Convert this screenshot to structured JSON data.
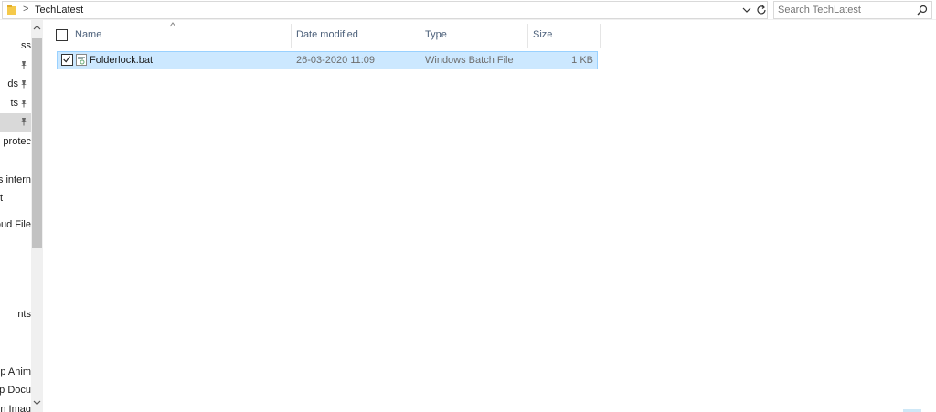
{
  "address_bar": {
    "breadcrumb_separator": ">",
    "current_folder": "TechLatest"
  },
  "search": {
    "placeholder": "Search TechLatest"
  },
  "nav_pane": {
    "items": [
      {
        "label": "ss",
        "pinned": false
      },
      {
        "label": "",
        "pinned": true
      },
      {
        "label": "ds",
        "pinned": true
      },
      {
        "label": "ts",
        "pinned": true
      },
      {
        "label": "",
        "pinned": true,
        "selected": true
      },
      {
        "label": "l protec",
        "pinned": false
      },
      {
        "label": "s intern",
        "pinned": false
      },
      {
        "label": "t",
        "pinned": false
      },
      {
        "label": "oud File",
        "pinned": false
      },
      {
        "label": "nts",
        "pinned": false
      },
      {
        "label": "p Anim",
        "pinned": false
      },
      {
        "label": "p Docu",
        "pinned": false
      },
      {
        "label": "n Imag",
        "pinned": false
      }
    ]
  },
  "columns": {
    "name": "Name",
    "date_modified": "Date modified",
    "type": "Type",
    "size": "Size"
  },
  "files": [
    {
      "name": "Folderlock.bat",
      "date_modified": "26-03-2020 11:09",
      "type": "Windows Batch File",
      "size": "1 KB",
      "selected": true,
      "checked": true
    }
  ],
  "colors": {
    "selection_bg": "#cce8ff",
    "selection_border": "#99d1ff",
    "header_text": "#4c607a",
    "folder_yellow": "#f5c94a"
  },
  "icons": {
    "folder": "folder-icon",
    "refresh": "refresh-icon",
    "dropdown": "chevron-down-icon",
    "search": "search-icon",
    "pin": "pin-icon",
    "batch_file": "batch-file-icon"
  }
}
